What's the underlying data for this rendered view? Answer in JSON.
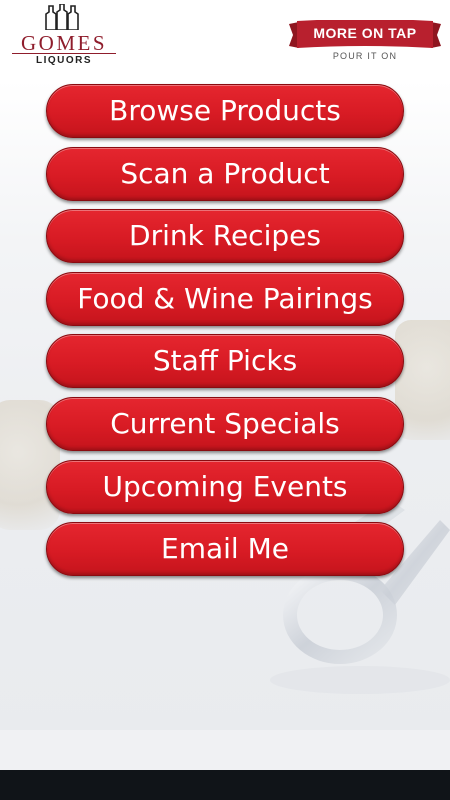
{
  "header": {
    "store_logo": {
      "name": "GOMES",
      "subtitle": "LIQUORS",
      "brand_color": "#8f1d2c"
    },
    "partner_logo": {
      "banner_text": "MORE ON TAP",
      "tagline": "POUR IT ON",
      "banner_color": "#b8202e"
    }
  },
  "menu": {
    "items": [
      {
        "label": "Browse Products"
      },
      {
        "label": "Scan a Product"
      },
      {
        "label": "Drink Recipes"
      },
      {
        "label": "Food & Wine Pairings"
      },
      {
        "label": "Staff Picks"
      },
      {
        "label": "Current Specials"
      },
      {
        "label": "Upcoming Events"
      },
      {
        "label": "Email Me"
      }
    ],
    "button_color": "#d81b24"
  },
  "navigation_bar": {
    "color": "#101418"
  }
}
